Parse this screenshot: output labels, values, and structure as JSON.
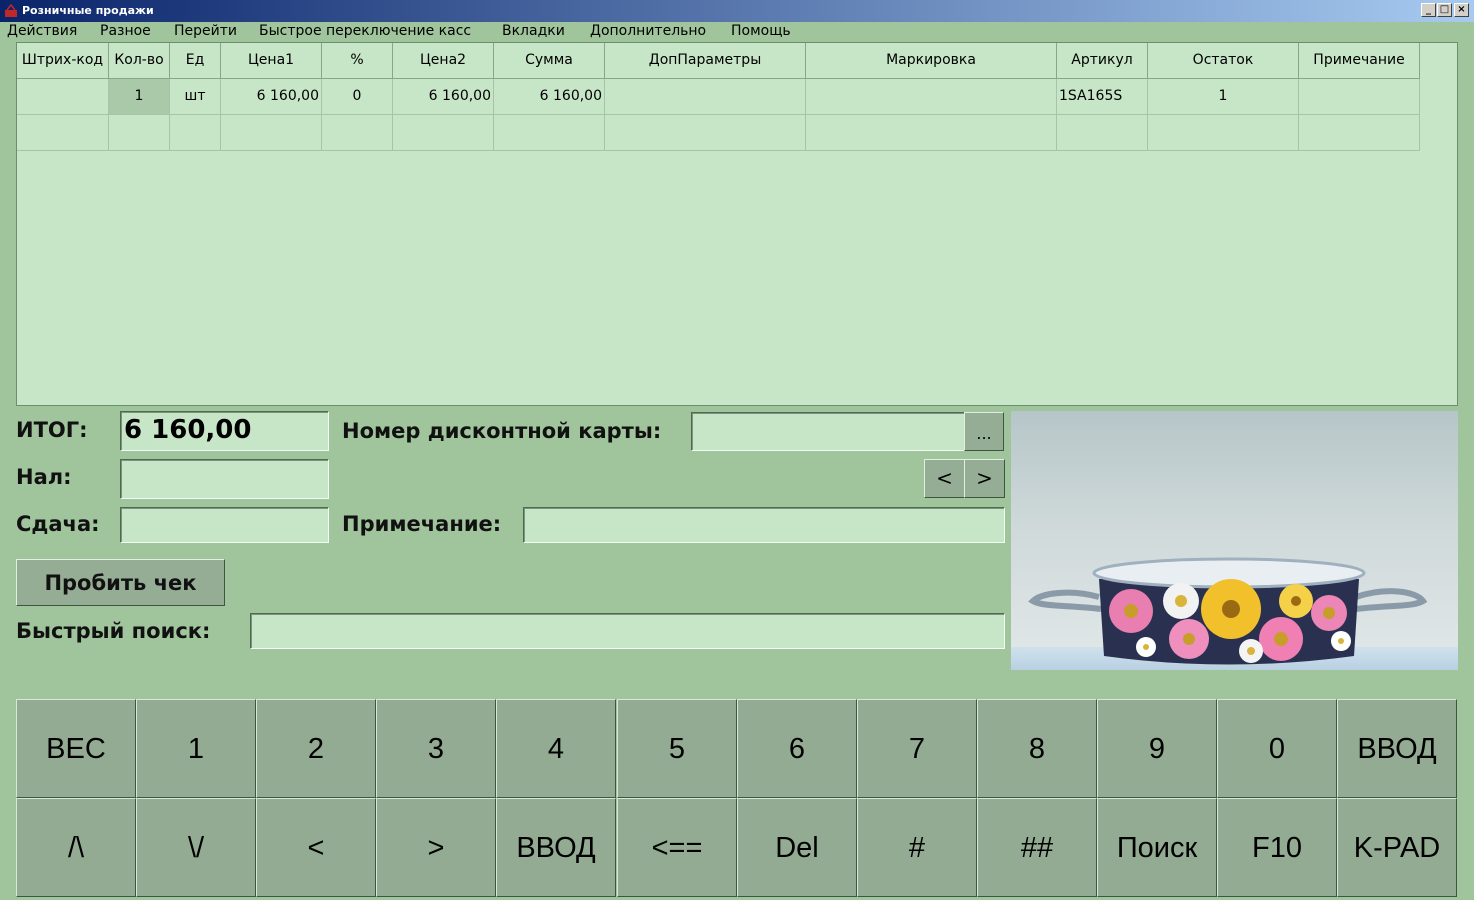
{
  "window": {
    "title": "Розничные продажи"
  },
  "menu": [
    "Действия",
    "Разное",
    "Перейти",
    "Быстрое переключение касс",
    "Вкладки",
    "Дополнительно",
    "Помощь"
  ],
  "grid": {
    "columns": [
      "Штрих-код",
      "Кол-во",
      "Ед",
      "Цена1",
      "%",
      "Цена2",
      "Сумма",
      "ДопПараметры",
      "Маркировка",
      "Артикул",
      "Остаток",
      "Примечание"
    ],
    "rows": [
      [
        "",
        "1",
        "шт",
        "6 160,00",
        "0",
        "6 160,00",
        "6 160,00",
        "",
        "",
        "1SA165S",
        "1",
        ""
      ],
      [
        "",
        "",
        "",
        "",
        "",
        "",
        "",
        "",
        "",
        "",
        "",
        ""
      ]
    ]
  },
  "form": {
    "total_label": "ИТОГ:",
    "total_value": "6 160,00",
    "cash_label": "Нал:",
    "cash_value": "",
    "change_label": "Сдача:",
    "change_value": "",
    "card_label": "Номер дисконтной карты:",
    "card_value": "",
    "card_browse": "...",
    "prev": "<",
    "next": ">",
    "note_label": "Примечание:",
    "note_value": "",
    "print_check": "Пробить чек",
    "quick_search_label": "Быстрый поиск:",
    "quick_search_value": ""
  },
  "keypad": {
    "row1": [
      "ВЕС",
      "1",
      "2",
      "3",
      "4",
      "5",
      "6",
      "7",
      "8",
      "9",
      "0",
      "ВВОД"
    ],
    "row2": [
      "/\\",
      "\\/",
      "<",
      ">",
      "ВВОД",
      "<==",
      "Del",
      "#",
      "##",
      "Поиск",
      "F10",
      "K-PAD"
    ]
  }
}
